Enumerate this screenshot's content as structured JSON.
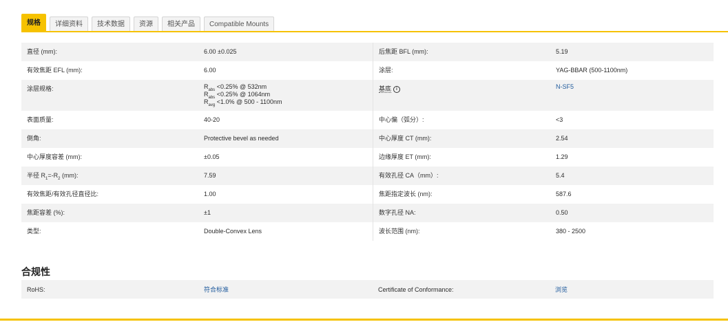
{
  "tabs": [
    {
      "label": "规格",
      "active": true
    },
    {
      "label": "详细资料"
    },
    {
      "label": "技术数据"
    },
    {
      "label": "资源"
    },
    {
      "label": "相关产品"
    },
    {
      "label": "Compatible Mounts"
    }
  ],
  "specs": [
    {
      "l1": "直径 (mm):",
      "v1": "6.00 ±0.025",
      "l2": "后焦距 BFL (mm):",
      "v2": "5.19"
    },
    {
      "l1": "有效焦距 EFL (mm):",
      "v1": "6.00",
      "l2": "涂层:",
      "v2": "YAG-BBAR (500-1100nm)"
    },
    {
      "l1": "涂层规格:",
      "coating": [
        {
          "r": "R",
          "sub": "abs",
          "text": " <0.25% @ 532nm"
        },
        {
          "r": "R",
          "sub": "abs",
          "text": " <0.25% @ 1064nm"
        },
        {
          "r": "R",
          "sub": "avg",
          "text": " <1.0% @ 500 - 1100nm"
        }
      ],
      "l2": "基底",
      "info": "i",
      "v2": "N-SF5"
    },
    {
      "l1": "表面质量:",
      "v1": "40-20",
      "l2": "中心偏（弧分）:",
      "v2": "<3"
    },
    {
      "l1": "倒角:",
      "v1": "Protective bevel as needed",
      "l2": "中心厚度 CT (mm):",
      "v2": "2.54"
    },
    {
      "l1": "中心厚度容差 (mm):",
      "v1": "±0.05",
      "l2": "边缘厚度 ET (mm):",
      "v2": "1.29"
    },
    {
      "l1a": "半径 R",
      "l1s1": "1",
      "l1b": "=-R",
      "l1s2": "2",
      "l1c": " (mm):",
      "v1": "7.59",
      "l2": "有效孔径 CA（mm）:",
      "v2": "5.4"
    },
    {
      "l1": "有效焦距/有效孔径直径比:",
      "v1": "1.00",
      "l2": "焦距指定波长 (nm):",
      "v2": "587.6"
    },
    {
      "l1": "焦距容差 (%):",
      "v1": "±1",
      "l2": "数字孔径 NA:",
      "v2": "0.50"
    },
    {
      "l1": "类型:",
      "v1": "Double-Convex Lens",
      "l2": "波长范围 (nm):",
      "v2": "380 - 2500"
    }
  ],
  "compliance": {
    "title": "合规性",
    "rohs_label": "RoHS:",
    "rohs_value": "符合标准",
    "coc_label": "Certificate of Conformance:",
    "coc_value": "浏览"
  },
  "colors": {
    "accent": "#f6c200",
    "link": "#1f5a9c",
    "row_shade": "#f2f2f2"
  }
}
